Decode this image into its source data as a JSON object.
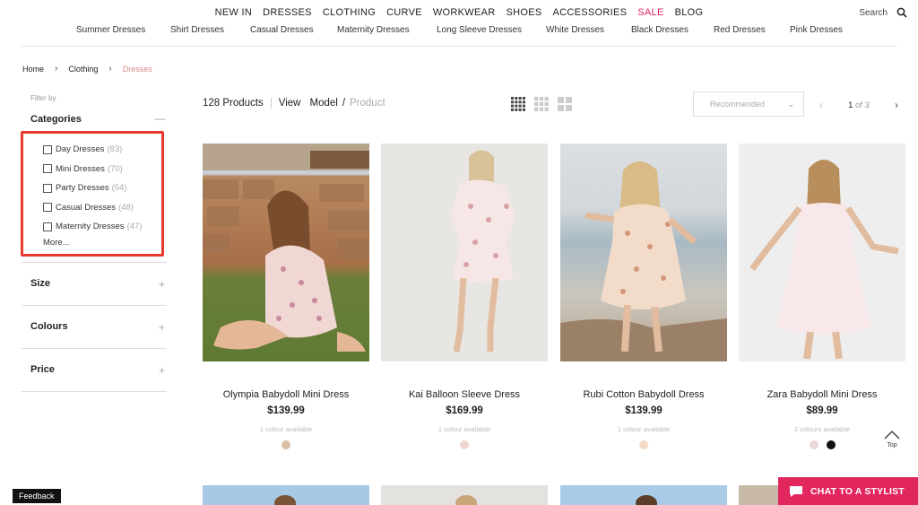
{
  "nav": {
    "main": [
      "NEW IN",
      "DRESSES",
      "CLOTHING",
      "CURVE",
      "WORKWEAR",
      "SHOES",
      "ACCESSORIES",
      "SALE",
      "BLOG"
    ],
    "sub": [
      "Summer Dresses",
      "Shirt Dresses",
      "Casual Dresses",
      "Maternity Dresses",
      "Long Sleeve Dresses",
      "White Dresses",
      "Black Dresses",
      "Red Dresses",
      "Pink Dresses"
    ],
    "search_label": "Search",
    "sale_color": "#e2265e"
  },
  "breadcrumb": [
    "Home",
    "Clothing",
    "Dresses"
  ],
  "sidebar": {
    "filter_by": "Filter by",
    "categories_title": "Categories",
    "categories": [
      {
        "label": "Day Dresses",
        "count": "(83)"
      },
      {
        "label": "Mini Dresses",
        "count": "(70)"
      },
      {
        "label": "Party Dresses",
        "count": "(54)"
      },
      {
        "label": "Casual Dresses",
        "count": "(48)"
      },
      {
        "label": "Maternity Dresses",
        "count": "(47)"
      }
    ],
    "more": "More...",
    "facets": [
      "Size",
      "Colours",
      "Price"
    ],
    "highlight_color": "#e8392a"
  },
  "toolbar": {
    "count": "128 Products",
    "view": "View",
    "model": "Model",
    "slash": "/",
    "product": "Product",
    "sort": "Recommended",
    "page_current": "1",
    "page_of": "of 3"
  },
  "products": [
    {
      "name": "Olympia Babydoll Mini Dress",
      "price": "$139.99",
      "colours": "1 colour available",
      "swatches": [
        "#d9bfa8"
      ]
    },
    {
      "name": "Kai Balloon Sleeve Dress",
      "price": "$169.99",
      "colours": "1 colour available",
      "swatches": [
        "#f0d6cf"
      ]
    },
    {
      "name": "Rubi Cotton Babydoll Dress",
      "price": "$139.99",
      "colours": "1 colour available",
      "swatches": [
        "#f3dcc7"
      ]
    },
    {
      "name": "Zara Babydoll Mini Dress",
      "price": "$89.99",
      "colours": "2 colours available",
      "swatches": [
        "#ead8d8",
        "#111111"
      ]
    }
  ],
  "floating": {
    "top": "Top",
    "feedback": "Feedback",
    "stylist": "CHAT TO A STYLIST",
    "stylist_color": "#e2265e"
  }
}
